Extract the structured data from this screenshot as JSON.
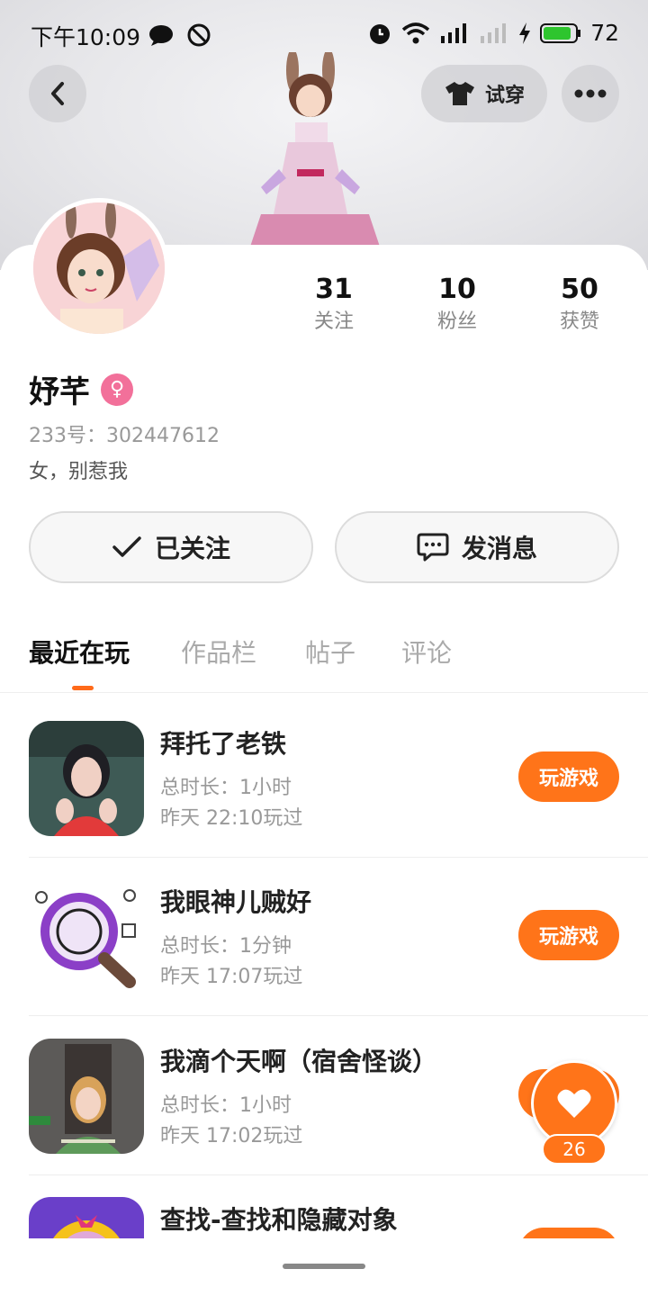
{
  "status_bar": {
    "time": "下午10:09",
    "battery": "72"
  },
  "top_bar": {
    "tryon_label": "试穿"
  },
  "profile": {
    "name": "妤芊",
    "gender_symbol": "♀",
    "uid": "233号：302447612",
    "bio": "女，别惹我",
    "stats": [
      {
        "value": "31",
        "label": "关注"
      },
      {
        "value": "10",
        "label": "粉丝"
      },
      {
        "value": "50",
        "label": "获赞"
      }
    ]
  },
  "actions": {
    "follow_label": "已关注",
    "message_label": "发消息"
  },
  "tabs": [
    "最近在玩",
    "作品栏",
    "帖子",
    "评论"
  ],
  "games": [
    {
      "title": "拜托了老铁",
      "duration": "总时长：1小时",
      "last_played": "昨天  22:10玩过",
      "button": "玩游戏"
    },
    {
      "title": "我眼神儿贼好",
      "duration": "总时长：1分钟",
      "last_played": "昨天  17:07玩过",
      "button": "玩游戏"
    },
    {
      "title": "我滴个天啊（宿舍怪谈）",
      "duration": "总时长：1小时",
      "last_played": "昨天  17:02玩过",
      "button": "玩游戏"
    },
    {
      "title": "查找-查找和隐藏对象",
      "duration": "",
      "last_played": "",
      "button": ""
    }
  ],
  "like_fab": {
    "count": "26"
  },
  "colors": {
    "accent": "#ff7419",
    "gender_badge": "#f2709a"
  }
}
